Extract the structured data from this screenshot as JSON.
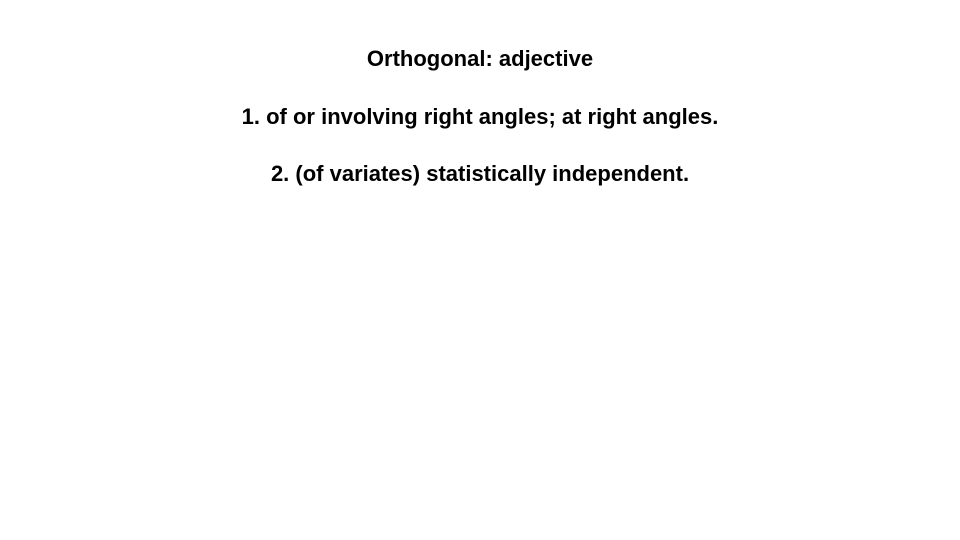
{
  "slide": {
    "heading": "Orthogonal: adjective",
    "definitions": [
      "1. of or involving right angles; at right angles.",
      "2. (of variates) statistically independent."
    ]
  }
}
